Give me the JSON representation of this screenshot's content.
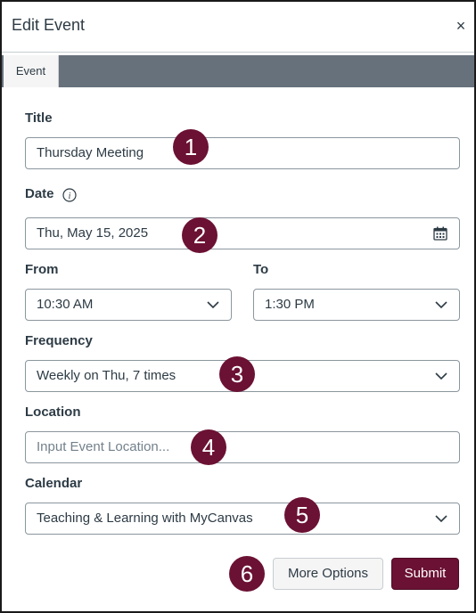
{
  "dialog": {
    "title": "Edit Event",
    "close_symbol": "×"
  },
  "tabs": [
    {
      "label": "Event"
    }
  ],
  "form": {
    "title": {
      "label": "Title",
      "value": "Thursday Meeting"
    },
    "date": {
      "label": "Date",
      "value": "Thu, May 15, 2025",
      "icon": "calendar-icon",
      "info_icon": "info-icon"
    },
    "from": {
      "label": "From",
      "value": "10:30 AM"
    },
    "to": {
      "label": "To",
      "value": "1:30 PM"
    },
    "frequency": {
      "label": "Frequency",
      "value": "Weekly on Thu, 7 times"
    },
    "location": {
      "label": "Location",
      "value": "",
      "placeholder": "Input Event Location..."
    },
    "calendar": {
      "label": "Calendar",
      "value": "Teaching & Learning with MyCanvas"
    }
  },
  "buttons": {
    "more_options": "More Options",
    "submit": "Submit"
  },
  "callouts": [
    "1",
    "2",
    "3",
    "4",
    "5",
    "6"
  ],
  "colors": {
    "accent": "#6b1133",
    "tab_bar": "#66717b",
    "text": "#2d3b45",
    "border": "#8b969e"
  }
}
